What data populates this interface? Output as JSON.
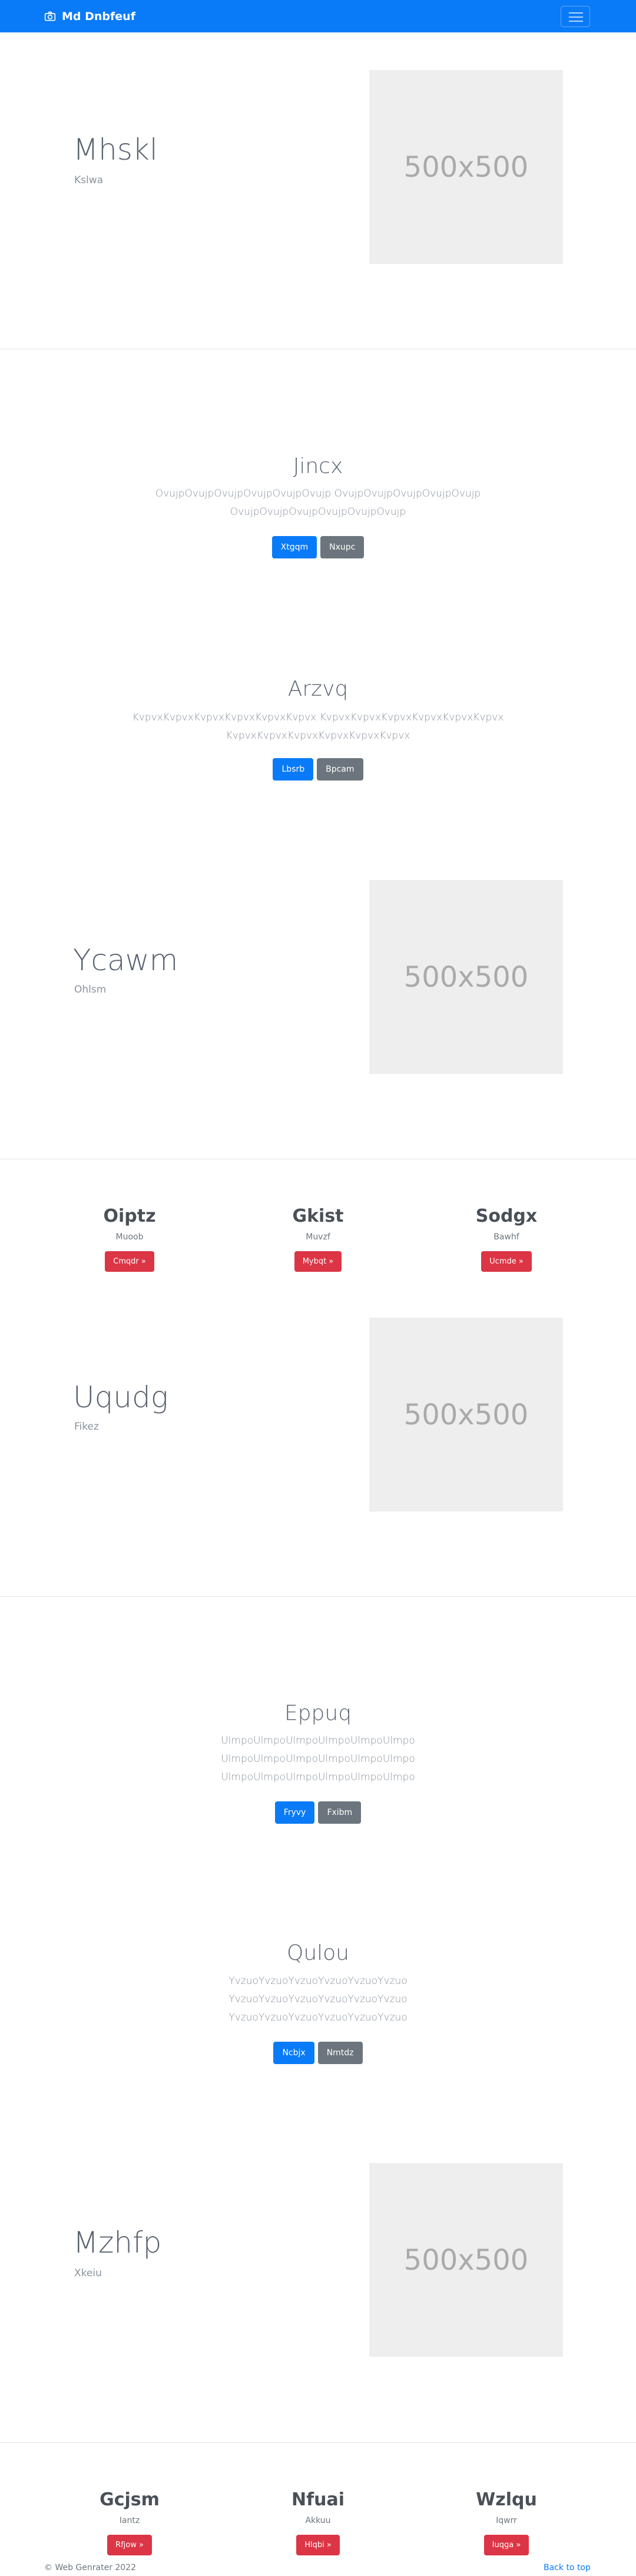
{
  "navbar": {
    "brand": "Md Dnbfeuf",
    "brand_icon": "camera-icon",
    "toggler_icon": "hamburger-icon"
  },
  "hero1": {
    "title": "Mhskl",
    "subtitle": "Kslwa",
    "image_text": "500x500"
  },
  "section1": {
    "title": "Jincx",
    "lines": [
      "OvujpOvujpOvujpOvujpOvujpOvujp OvujpOvujpOvujpOvujpOvujp",
      "OvujpOvujpOvujpOvujpOvujpOvujp"
    ],
    "primary_button": "Xtgqm",
    "secondary_button": "Nxupc"
  },
  "section2": {
    "title": "Arzvq",
    "lines": [
      "KvpvxKvpvxKvpvxKvpvxKvpvxKvpvx KvpvxKvpvxKvpvxKvpvxKvpvxKvpvx",
      "KvpvxKvpvxKvpvxKvpvxKvpvxKvpvx"
    ],
    "primary_button": "Lbsrb",
    "secondary_button": "Bpcam"
  },
  "hero2": {
    "title": "Ycawm",
    "subtitle": "Ohlsm",
    "image_text": "500x500"
  },
  "features1": [
    {
      "title": "Oiptz",
      "subtitle": "Muoob",
      "button": "Cmqdr »"
    },
    {
      "title": "Gkist",
      "subtitle": "Muvzf",
      "button": "Mybqt »"
    },
    {
      "title": "Sodgx",
      "subtitle": "Bawhf",
      "button": "Ucmde »"
    }
  ],
  "hero3": {
    "title": "Uqudg",
    "subtitle": "Fikez",
    "image_text": "500x500"
  },
  "section3": {
    "title": "Eppuq",
    "lines": [
      "UlmpoUlmpoUlmpoUlmpoUlmpoUlmpo",
      "UlmpoUlmpoUlmpoUlmpoUlmpoUlmpo",
      "UlmpoUlmpoUlmpoUlmpoUlmpoUlmpo"
    ],
    "primary_button": "Fryvy",
    "secondary_button": "Fxibm"
  },
  "section4": {
    "title": "Qulou",
    "lines": [
      "YvzuoYvzuoYvzuoYvzuoYvzuoYvzuo",
      "YvzuoYvzuoYvzuoYvzuoYvzuoYvzuo",
      "YvzuoYvzuoYvzuoYvzuoYvzuoYvzuo"
    ],
    "primary_button": "Ncbjx",
    "secondary_button": "Nmtdz"
  },
  "hero4": {
    "title": "Mzhfp",
    "subtitle": "Xkeiu",
    "image_text": "500x500"
  },
  "features2": [
    {
      "title": "Gcjsm",
      "subtitle": "Iantz",
      "button": "Rfjow »"
    },
    {
      "title": "Nfuai",
      "subtitle": "Akkuu",
      "button": "Hlqbi »"
    },
    {
      "title": "Wzlqu",
      "subtitle": "Iqwrr",
      "button": "Iuqga »"
    }
  ],
  "footer": {
    "copyright": "© Web Genrater 2022",
    "back_to_top": "Back to top"
  }
}
